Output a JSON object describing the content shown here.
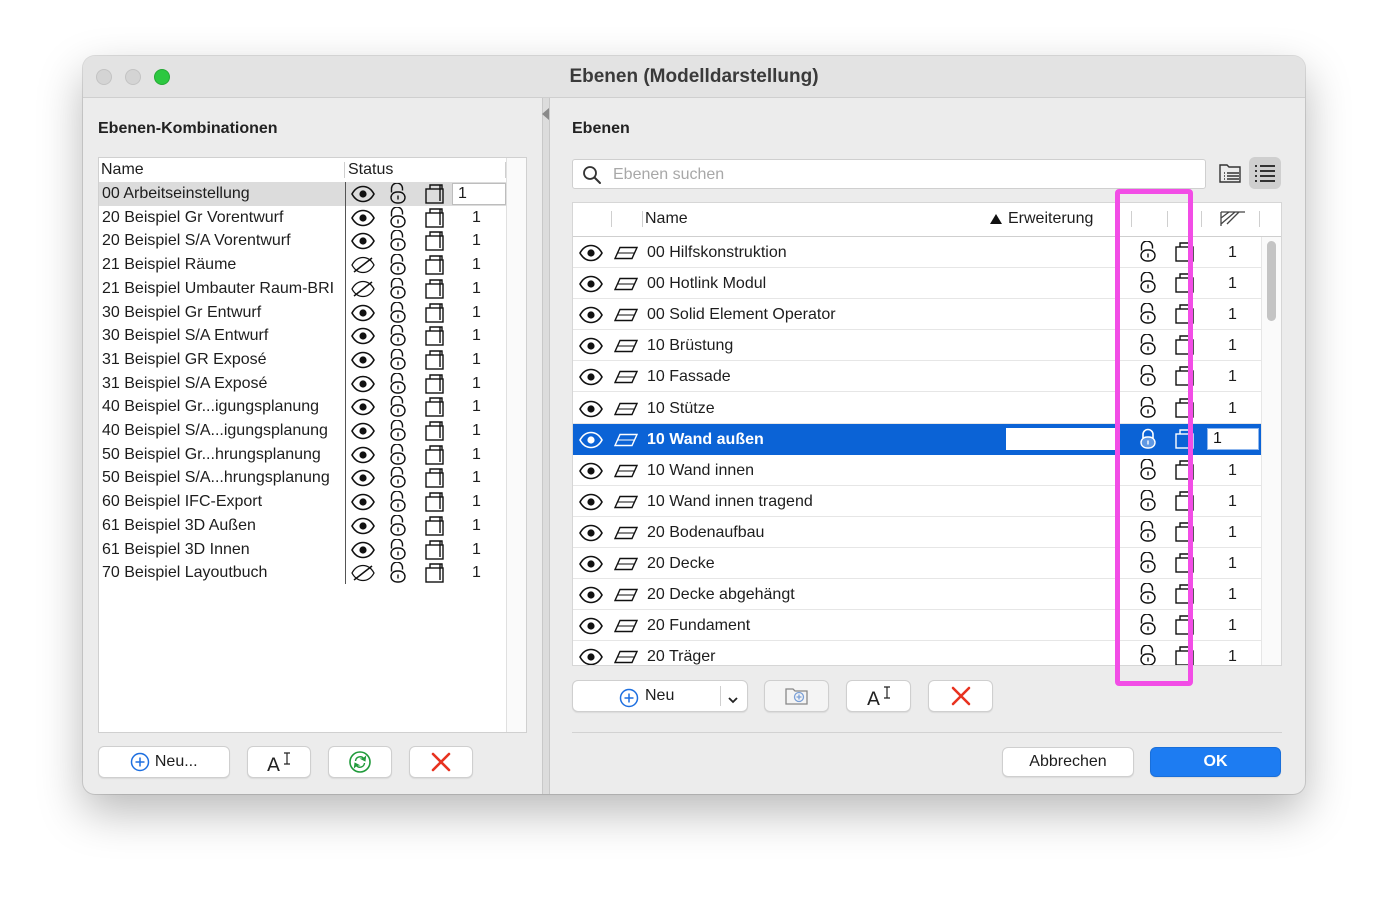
{
  "window": {
    "title": "Ebenen (Modelldarstellung)"
  },
  "combinations": {
    "title": "Ebenen-Kombinationen",
    "header_name": "Name",
    "header_status": "Status",
    "rows": [
      {
        "name": "00 Arbeitseinstellung",
        "visible": true,
        "num": "1",
        "selected": true
      },
      {
        "name": "20 Beispiel Gr Vorentwurf",
        "visible": true,
        "num": "1"
      },
      {
        "name": "20 Beispiel S/A Vorentwurf",
        "visible": true,
        "num": "1"
      },
      {
        "name": "21 Beispiel Räume",
        "visible": false,
        "num": "1"
      },
      {
        "name": "21 Beispiel Umbauter Raum-BRI",
        "visible": false,
        "num": "1"
      },
      {
        "name": "30 Beispiel Gr Entwurf",
        "visible": true,
        "num": "1"
      },
      {
        "name": "30 Beispiel S/A Entwurf",
        "visible": true,
        "num": "1"
      },
      {
        "name": "31 Beispiel GR Exposé",
        "visible": true,
        "num": "1"
      },
      {
        "name": "31 Beispiel S/A Exposé",
        "visible": true,
        "num": "1"
      },
      {
        "name": "40 Beispiel Gr...igungsplanung",
        "visible": true,
        "num": "1"
      },
      {
        "name": "40 Beispiel S/A...igungsplanung",
        "visible": true,
        "num": "1"
      },
      {
        "name": "50 Beispiel Gr...hrungsplanung",
        "visible": true,
        "num": "1"
      },
      {
        "name": "50 Beispiel S/A...hrungsplanung",
        "visible": true,
        "num": "1"
      },
      {
        "name": "60 Beispiel IFC-Export",
        "visible": true,
        "num": "1"
      },
      {
        "name": "61 Beispiel 3D Außen",
        "visible": true,
        "num": "1"
      },
      {
        "name": "61 Beispiel 3D Innen",
        "visible": true,
        "num": "1"
      },
      {
        "name": "70 Beispiel Layoutbuch",
        "visible": false,
        "num": "1"
      }
    ],
    "new_label": "Neu..."
  },
  "layers": {
    "title": "Ebenen",
    "search_placeholder": "Ebenen suchen",
    "header_name": "Name",
    "header_ext": "Erweiterung",
    "rows": [
      {
        "name": "00 Hilfskonstruktion",
        "num": "1"
      },
      {
        "name": "00 Hotlink Modul",
        "num": "1"
      },
      {
        "name": "00 Solid Element Operator",
        "num": "1"
      },
      {
        "name": "10 Brüstung",
        "num": "1"
      },
      {
        "name": "10 Fassade",
        "num": "1"
      },
      {
        "name": "10 Stütze",
        "num": "1"
      },
      {
        "name": "10 Wand außen",
        "num": "1",
        "selected": true
      },
      {
        "name": "10 Wand innen",
        "num": "1"
      },
      {
        "name": "10 Wand innen tragend",
        "num": "1"
      },
      {
        "name": "20 Bodenaufbau",
        "num": "1"
      },
      {
        "name": "20 Decke",
        "num": "1"
      },
      {
        "name": "20 Decke abgehängt",
        "num": "1"
      },
      {
        "name": "20 Fundament",
        "num": "1"
      },
      {
        "name": "20 Träger",
        "num": "1"
      }
    ],
    "new_label": "Neu"
  },
  "footer": {
    "cancel_label": "Abbrechen",
    "ok_label": "OK"
  },
  "colors": {
    "selection": "#0b63d6",
    "primary": "#1d7cf2",
    "highlight": "#f24de6",
    "delete": "#e8321f",
    "refresh": "#1f9a3a"
  }
}
